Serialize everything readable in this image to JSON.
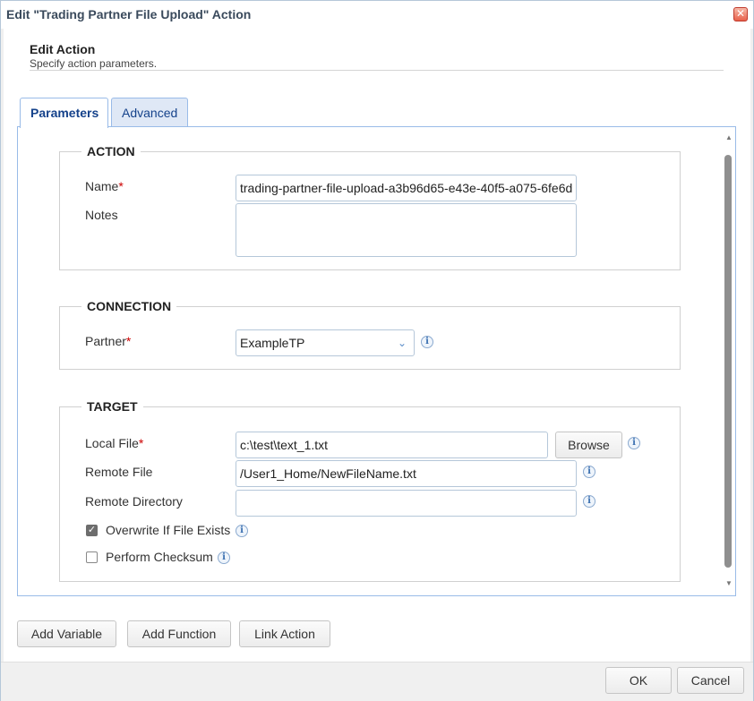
{
  "window": {
    "title": "Edit \"Trading Partner File Upload\" Action",
    "close_glyph": "✕"
  },
  "header": {
    "title": "Edit Action",
    "subtitle": "Specify action parameters."
  },
  "tabs": [
    {
      "label": "Parameters",
      "active": true
    },
    {
      "label": "Advanced",
      "active": false
    }
  ],
  "sections": {
    "action": {
      "legend": "ACTION",
      "name_label": "Name",
      "name_value": "trading-partner-file-upload-a3b96d65-e43e-40f5-a075-6fe6d",
      "notes_label": "Notes",
      "notes_value": ""
    },
    "connection": {
      "legend": "CONNECTION",
      "partner_label": "Partner",
      "partner_value": "ExampleTP"
    },
    "target": {
      "legend": "TARGET",
      "local_file_label": "Local File",
      "local_file_value": "c:\\test\\text_1.txt",
      "browse_label": "Browse",
      "remote_file_label": "Remote File",
      "remote_file_value": "/User1_Home/NewFileName.txt",
      "remote_dir_label": "Remote Directory",
      "remote_dir_value": "",
      "overwrite_label": "Overwrite If File Exists",
      "overwrite_checked": true,
      "checksum_label": "Perform Checksum",
      "checksum_checked": false
    }
  },
  "required_marker": "*",
  "buttons": {
    "add_variable": "Add Variable",
    "add_function": "Add Function",
    "link_action": "Link Action",
    "ok": "OK",
    "cancel": "Cancel"
  },
  "icons": {
    "info": "info-icon",
    "combo_arrow": "chevron-down-icon",
    "close": "close-icon",
    "check": "checkmark-icon"
  }
}
